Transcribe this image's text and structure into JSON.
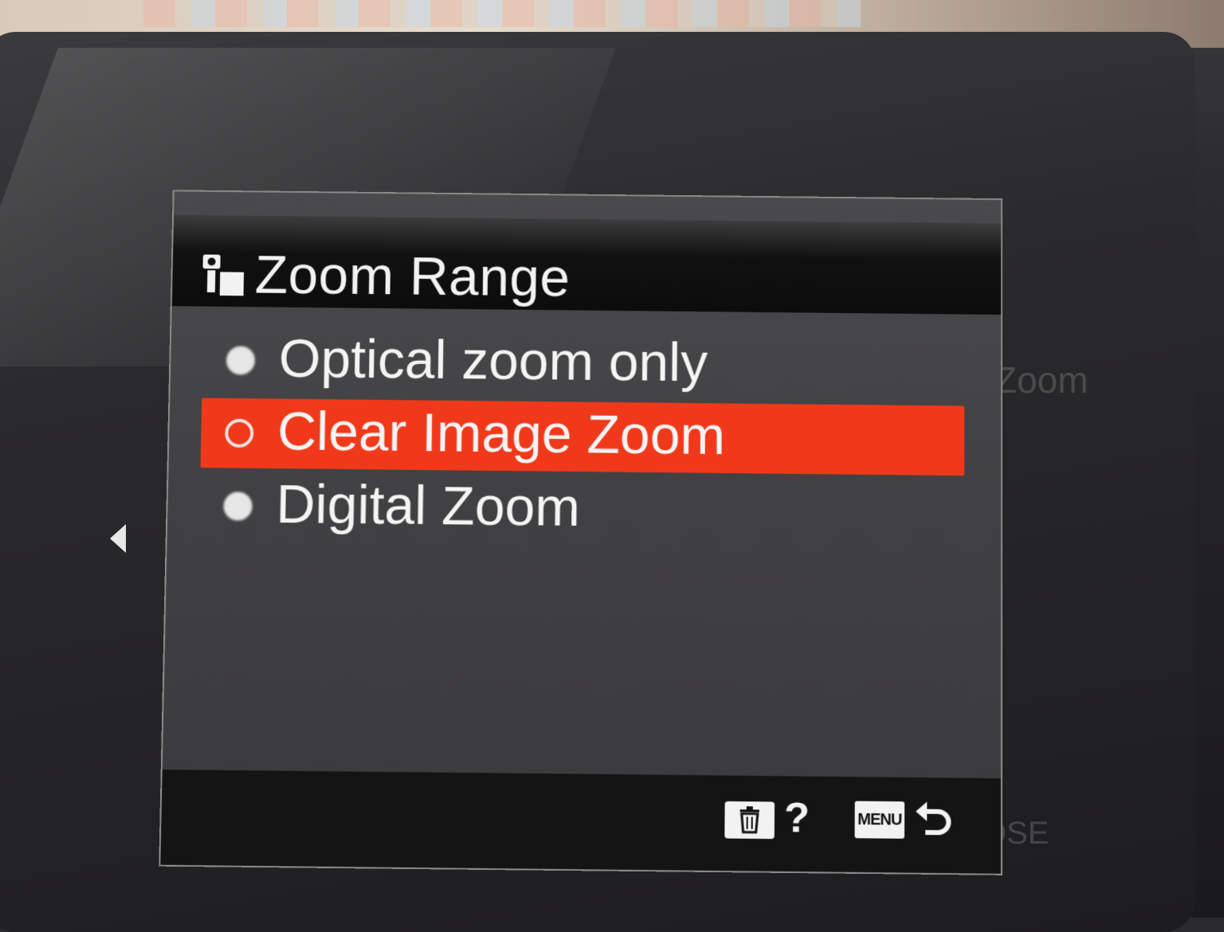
{
  "screen": {
    "title": "Zoom Range",
    "title_icon": "camera-settings-icon",
    "options": [
      {
        "label": "Optical zoom only",
        "selected": false
      },
      {
        "label": "Clear Image Zoom",
        "selected": true
      },
      {
        "label": "Digital Zoom",
        "selected": false
      }
    ],
    "footer": {
      "trash_icon": "trash-icon",
      "help_label": "?",
      "menu_label": "MENU",
      "back_icon": "return-arrow-icon"
    }
  },
  "colors": {
    "highlight": "#f0391a",
    "text": "#f4f4f4",
    "header_bg": "#111112",
    "panel_bg": "#414042"
  }
}
